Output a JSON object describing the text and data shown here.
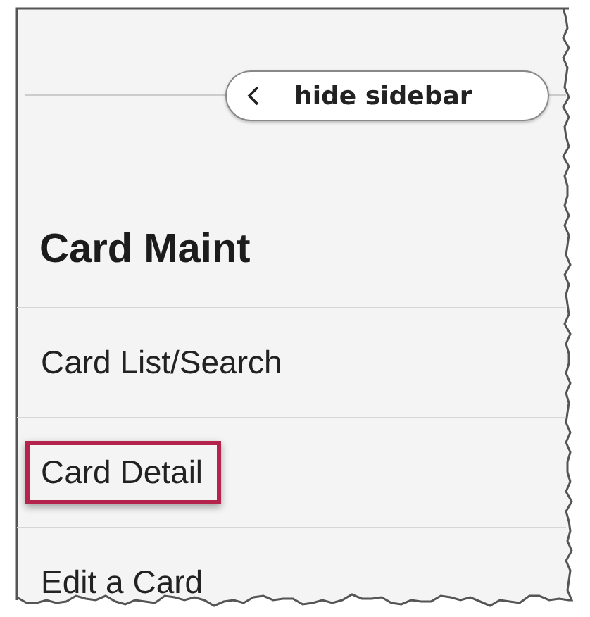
{
  "sidebar_toggle": {
    "label": "hide sidebar"
  },
  "section": {
    "title": "Card Maint"
  },
  "menu_items": [
    {
      "label": "Card List/Search",
      "highlighted": false
    },
    {
      "label": "Card Detail",
      "highlighted": true
    },
    {
      "label": "Edit a Card",
      "highlighted": false
    }
  ]
}
